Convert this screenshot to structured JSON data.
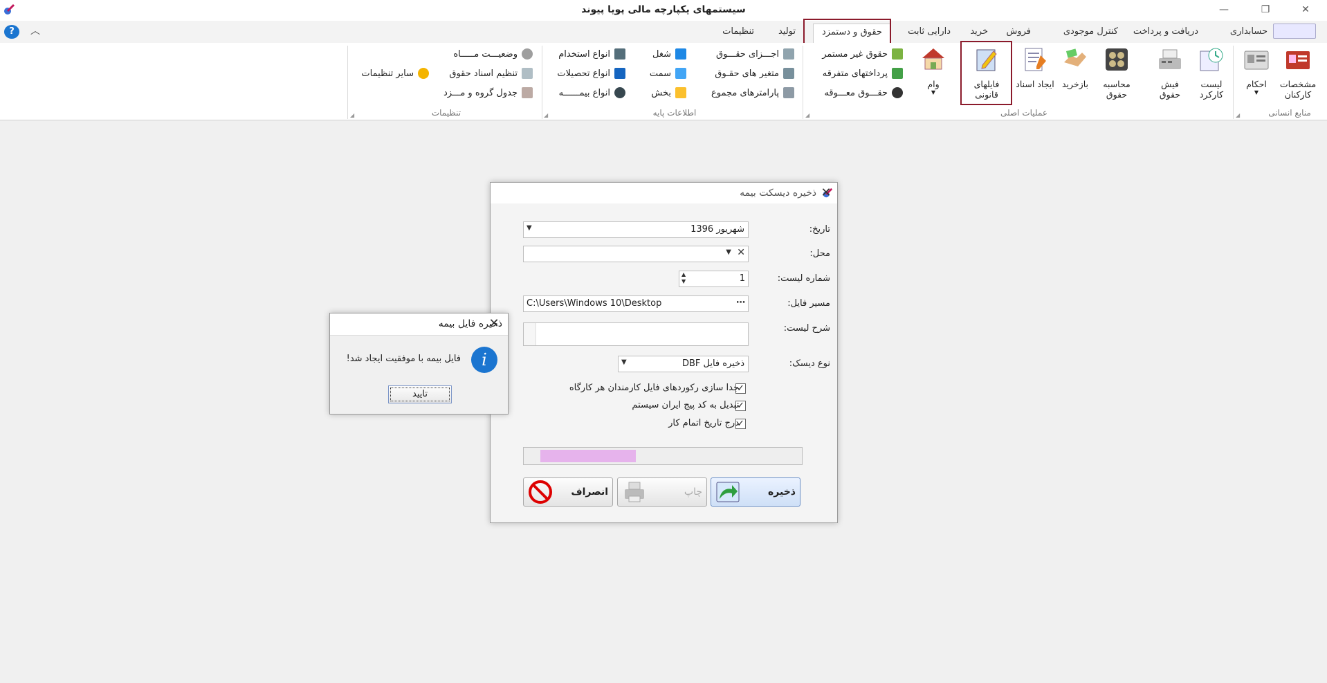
{
  "window": {
    "title": "سیستمهای یکپارچه مالی پویا پیوند",
    "minimize_icon": "minimize-icon",
    "restore_icon": "restore-icon",
    "close_icon": "close-icon"
  },
  "tabs": [
    {
      "label": "حسابداری"
    },
    {
      "label": "دریافت و پرداخت"
    },
    {
      "label": "کنترل موجودی"
    },
    {
      "label": "فروش"
    },
    {
      "label": "خرید"
    },
    {
      "label": "دارایی ثابت"
    },
    {
      "label": "حقوق و دستمزد",
      "active": true
    },
    {
      "label": "تولید"
    },
    {
      "label": "تنظیمات"
    }
  ],
  "ribbon": {
    "hr_group": {
      "label": "منابع انسانی",
      "employees": "مشخصات کارکنان",
      "decrees": "احکام"
    },
    "main_ops": {
      "label": "عملیات اصلی",
      "timesheet": "لیست کارکرد",
      "payslip": "فیش حقوق",
      "calc_salary": "محاسبه حقوق",
      "recalc": "بازخرید",
      "create_docs": "ایجاد اسناد",
      "legal_files": "فایلهای قانونی",
      "loan": "وام",
      "non_continuous": "حقوق غیر مستمر",
      "misc_payments": "پرداختهای متفرقه",
      "deferred_salary": "حقـــوق معـــوقه"
    },
    "base_info": {
      "label": "اطلاعات پایه",
      "salary_parts": "اجـــزای حقـــوق",
      "salary_vars": "متغیر های حقـوق",
      "total_params": "پارامترهای مجموع",
      "job": "شغل",
      "position": "سمت",
      "section": "بخش",
      "employment_types": "انواع استخدام",
      "education_types": "انواع تحصیلات",
      "insurance_types": "انواع بیمــــــه"
    },
    "settings": {
      "label": "تنظیمات",
      "month_status": "وضعیـــت مـــــاه",
      "salary_doc_setup": "تنظیم اسناد حقوق",
      "wage_table": "جدول گروه و مـــزد",
      "other_settings": "سایر تنظیمات"
    }
  },
  "insurance_dialog": {
    "title": "ذخیره دیسکت بیمه",
    "date_label": "تاریخ:",
    "date_value": "شهریور 1396",
    "location_label": "محل:",
    "location_value": "",
    "list_no_label": "شماره لیست:",
    "list_no_value": "1",
    "path_label": "مسیر فایل:",
    "path_value": "C:\\Users\\Windows 10\\Desktop",
    "desc_label": "شرح لیست:",
    "desc_value": "",
    "disk_type_label": "نوع دیسک:",
    "disk_type_value": "ذخیره فایل DBF",
    "chk_separate": "جدا سازی رکوردهای فایل کارمندان هر کارگاه",
    "chk_convert": "تبدیل به کد پیج ایران سیستم",
    "chk_end_date": "درج تاریخ اتمام کار",
    "progress": 0.37,
    "save_label": "ذخیره",
    "print_label": "چاپ",
    "cancel_label": "انصراف"
  },
  "message_box": {
    "title": "ذخیره فایل بیمه",
    "message": "فایل بیمه با موفقیت ایجاد شد!",
    "ok_label": "تایید",
    "icon": "info-icon"
  },
  "colors": {
    "highlight_box": "#8b1a2b",
    "progress_fill": "#e6b3ec",
    "info_blue": "#1b75d0"
  }
}
